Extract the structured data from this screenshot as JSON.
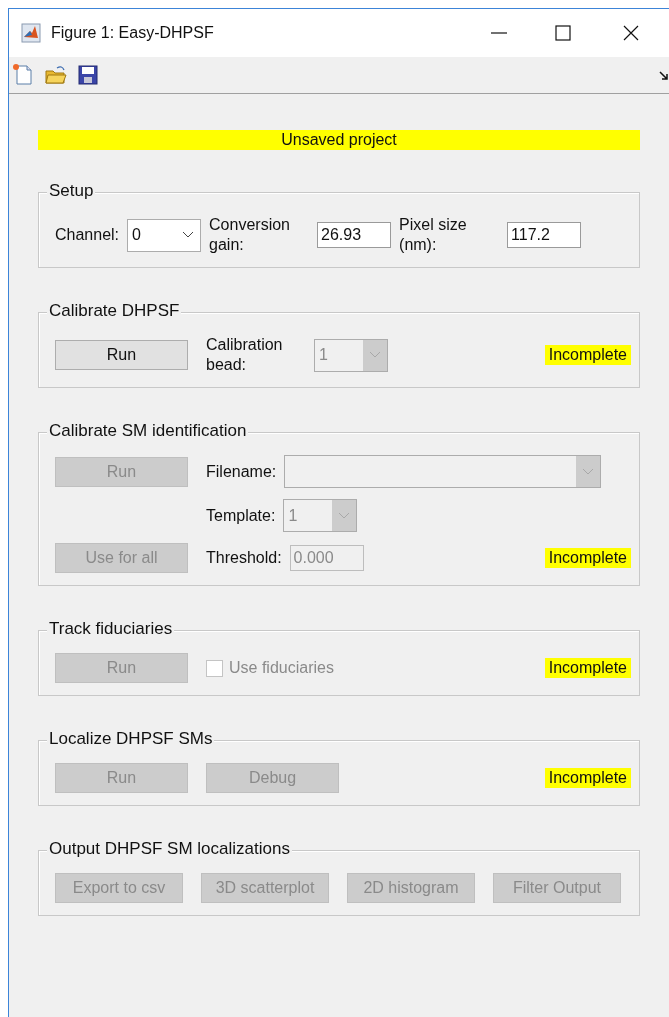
{
  "window": {
    "title": "Figure 1: Easy-DHPSF"
  },
  "banner": {
    "text": "Unsaved project"
  },
  "sections": [
    {
      "title": "Setup",
      "rows": [
        {
          "items": [
            {
              "kind": "label",
              "text": "Channel:"
            },
            {
              "kind": "dropdown",
              "value": "0",
              "disabled": false
            },
            {
              "kind": "label",
              "text": "Conversion gain:"
            },
            {
              "kind": "field",
              "value": "26.93",
              "disabled": false
            },
            {
              "kind": "label",
              "text": "Pixel size (nm):"
            },
            {
              "kind": "field",
              "value": "117.2",
              "disabled": false
            }
          ]
        }
      ]
    },
    {
      "title": "Calibrate DHPSF",
      "rows": [
        {
          "items": [
            {
              "kind": "button",
              "text": "Run",
              "disabled": false
            },
            {
              "kind": "label",
              "text": "Calibration bead:"
            },
            {
              "kind": "dropdown",
              "value": "1",
              "disabled": true
            }
          ],
          "status": "Incomplete"
        }
      ]
    },
    {
      "title": "Calibrate SM identification",
      "rows": [
        {
          "items": [
            {
              "kind": "button",
              "text": "Run",
              "disabled": true
            },
            {
              "kind": "label",
              "text": "Filename:"
            },
            {
              "kind": "dropdown",
              "value": "",
              "disabled": true,
              "wide": true
            }
          ]
        },
        {
          "items": [
            {
              "kind": "label",
              "text": "Template:"
            },
            {
              "kind": "dropdown",
              "value": "1",
              "disabled": true
            }
          ]
        },
        {
          "items": [
            {
              "kind": "button",
              "text": "Use for all",
              "disabled": true
            },
            {
              "kind": "label",
              "text": "Threshold:"
            },
            {
              "kind": "field",
              "value": "0.000",
              "disabled": true
            }
          ],
          "status": "Incomplete"
        }
      ]
    },
    {
      "title": "Track fiduciaries",
      "rows": [
        {
          "items": [
            {
              "kind": "button",
              "text": "Run",
              "disabled": true
            },
            {
              "kind": "checkbox",
              "text": "Use fiduciaries",
              "checked": false,
              "disabled": true
            }
          ],
          "status": "Incomplete"
        }
      ]
    },
    {
      "title": "Localize DHPSF SMs",
      "rows": [
        {
          "items": [
            {
              "kind": "button",
              "text": "Run",
              "disabled": true
            },
            {
              "kind": "button",
              "text": "Debug",
              "disabled": true
            }
          ],
          "status": "Incomplete"
        }
      ]
    },
    {
      "title": "Output DHPSF SM localizations",
      "rows": [
        {
          "items": [
            {
              "kind": "button",
              "text": "Export to csv",
              "disabled": true
            },
            {
              "kind": "button",
              "text": "3D scatterplot",
              "disabled": true
            },
            {
              "kind": "button",
              "text": "2D histogram",
              "disabled": true
            },
            {
              "kind": "button",
              "text": "Filter Output",
              "disabled": true
            }
          ]
        }
      ]
    }
  ]
}
